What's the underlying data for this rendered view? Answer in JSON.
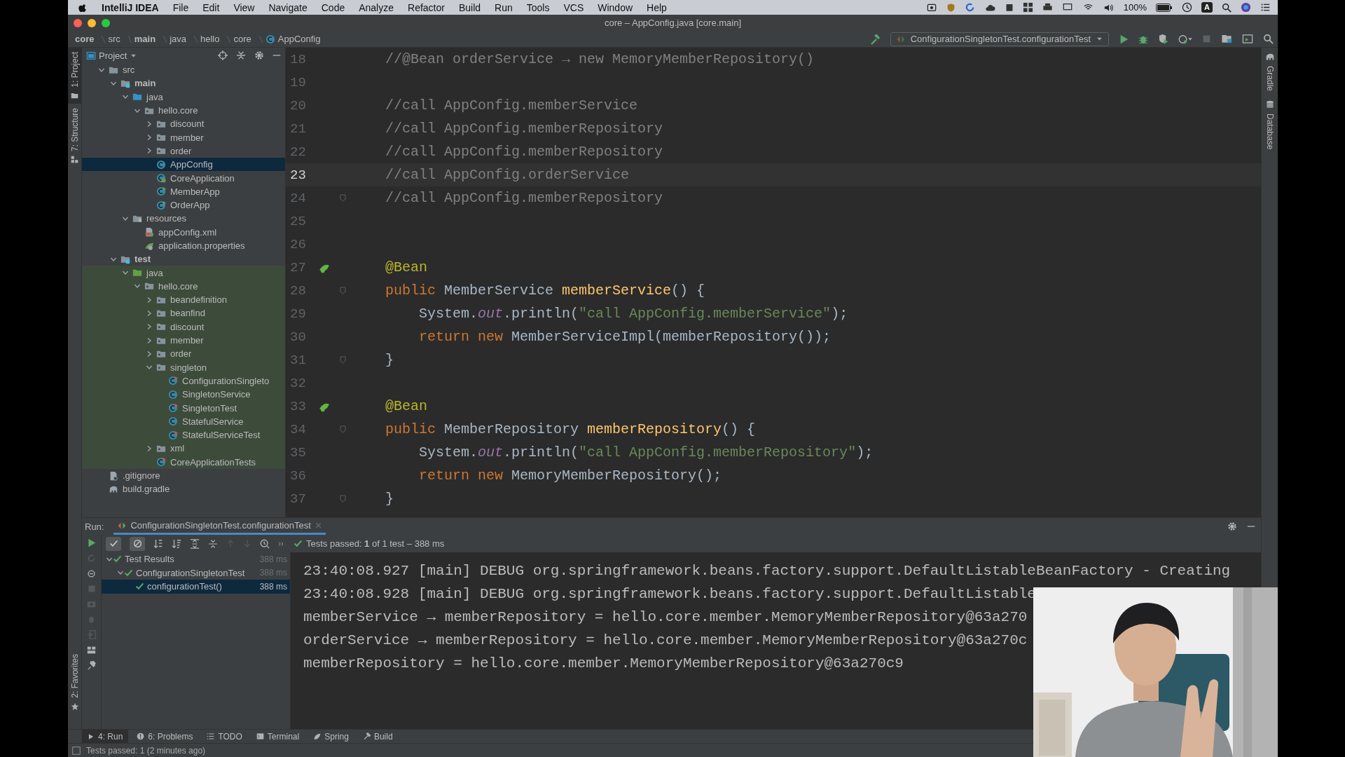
{
  "menu_bar": {
    "app": "IntelliJ IDEA",
    "items": [
      "File",
      "Edit",
      "View",
      "Navigate",
      "Code",
      "Analyze",
      "Refactor",
      "Build",
      "Run",
      "Tools",
      "VCS",
      "Window",
      "Help"
    ],
    "battery": "100%",
    "input_source": "A"
  },
  "window": {
    "title": "core – AppConfig.java [core.main]"
  },
  "breadcrumb": [
    {
      "label": "core",
      "kind": "module"
    },
    {
      "label": "src",
      "kind": "folder"
    },
    {
      "label": "main",
      "kind": "module"
    },
    {
      "label": "java",
      "kind": "folder"
    },
    {
      "label": "hello",
      "kind": "folder"
    },
    {
      "label": "core",
      "kind": "folder"
    },
    {
      "label": "AppConfig",
      "kind": "class"
    }
  ],
  "run_config": {
    "label": "ConfigurationSingletonTest.configurationTest"
  },
  "left_tool_tabs": [
    {
      "label": "1: Project",
      "selected": true
    },
    {
      "label": "7: Structure",
      "selected": false
    }
  ],
  "favorites_tab": {
    "label": "2: Favorites"
  },
  "right_tool_tabs": [
    {
      "label": "Gradle"
    },
    {
      "label": "Database"
    }
  ],
  "project_panel": {
    "title": "Project",
    "tree": [
      {
        "label": "src",
        "kind": "folder",
        "selected": false,
        "expanded": true,
        "children": [
          {
            "label": "main",
            "kind": "module",
            "selected": false,
            "expanded": true,
            "children": [
              {
                "label": "java",
                "kind": "source-root",
                "selected": false,
                "expanded": true,
                "children": [
                  {
                    "label": "hello.core",
                    "kind": "package",
                    "selected": false,
                    "expanded": true,
                    "children": [
                      {
                        "label": "discount",
                        "kind": "package",
                        "selected": false,
                        "expanded": false
                      },
                      {
                        "label": "member",
                        "kind": "package",
                        "selected": false,
                        "expanded": false
                      },
                      {
                        "label": "order",
                        "kind": "package",
                        "selected": false,
                        "expanded": false
                      },
                      {
                        "label": "AppConfig",
                        "kind": "class",
                        "selected": true
                      },
                      {
                        "label": "CoreApplication",
                        "kind": "spring-class",
                        "selected": false
                      },
                      {
                        "label": "MemberApp",
                        "kind": "runnable-class",
                        "selected": false
                      },
                      {
                        "label": "OrderApp",
                        "kind": "runnable-class",
                        "selected": false
                      }
                    ]
                  }
                ]
              },
              {
                "label": "resources",
                "kind": "resources-root",
                "selected": false,
                "expanded": true,
                "children": [
                  {
                    "label": "appConfig.xml",
                    "kind": "xml",
                    "selected": false
                  },
                  {
                    "label": "application.properties",
                    "kind": "properties",
                    "selected": false
                  }
                ]
              }
            ]
          },
          {
            "label": "test",
            "kind": "module",
            "selected": false,
            "expanded": true,
            "children": [
              {
                "label": "java",
                "kind": "test-root",
                "selected": false,
                "expanded": true,
                "children": [
                  {
                    "label": "hello.core",
                    "kind": "package",
                    "selected": false,
                    "expanded": true,
                    "children": [
                      {
                        "label": "beandefinition",
                        "kind": "package",
                        "selected": false,
                        "expanded": false
                      },
                      {
                        "label": "beanfind",
                        "kind": "package",
                        "selected": false,
                        "expanded": false
                      },
                      {
                        "label": "discount",
                        "kind": "package",
                        "selected": false,
                        "expanded": false
                      },
                      {
                        "label": "member",
                        "kind": "package",
                        "selected": false,
                        "expanded": false
                      },
                      {
                        "label": "order",
                        "kind": "package",
                        "selected": false,
                        "expanded": false
                      },
                      {
                        "label": "singleton",
                        "kind": "package",
                        "selected": false,
                        "expanded": true,
                        "children": [
                          {
                            "label": "ConfigurationSingleto",
                            "kind": "test-class",
                            "selected": false
                          },
                          {
                            "label": "SingletonService",
                            "kind": "class",
                            "selected": false
                          },
                          {
                            "label": "SingletonTest",
                            "kind": "test-class",
                            "selected": false
                          },
                          {
                            "label": "StatefulService",
                            "kind": "class",
                            "selected": false
                          },
                          {
                            "label": "StatefulServiceTest",
                            "kind": "test-class",
                            "selected": false
                          }
                        ]
                      },
                      {
                        "label": "xml",
                        "kind": "package",
                        "selected": false,
                        "expanded": false
                      },
                      {
                        "label": "CoreApplicationTests",
                        "kind": "test-class",
                        "selected": false
                      }
                    ]
                  }
                ]
              }
            ]
          }
        ]
      },
      {
        "label": ".gitignore",
        "kind": "file",
        "selected": false
      },
      {
        "label": "build.gradle",
        "kind": "gradle",
        "selected": false
      }
    ]
  },
  "editor": {
    "lines": [
      {
        "number": "18",
        "kind": "top",
        "current": false,
        "fold": false,
        "bean_marker": false,
        "tokens": [
          {
            "kind": "comment",
            "text": "//@Bean orderService → new MemoryMemberRepository()"
          }
        ]
      },
      {
        "number": "19",
        "kind": "blank",
        "current": false,
        "fold": false,
        "bean_marker": false
      },
      {
        "number": "20",
        "kind": "top",
        "current": false,
        "fold": false,
        "bean_marker": false,
        "tokens": [
          {
            "kind": "comment",
            "text": "//call AppConfig.memberService"
          }
        ]
      },
      {
        "number": "21",
        "kind": "top",
        "current": false,
        "fold": false,
        "bean_marker": false,
        "tokens": [
          {
            "kind": "comment",
            "text": "//call AppConfig.memberRepository"
          }
        ]
      },
      {
        "number": "22",
        "kind": "top",
        "current": false,
        "fold": false,
        "bean_marker": false,
        "tokens": [
          {
            "kind": "comment",
            "text": "//call AppConfig.memberRepository"
          }
        ]
      },
      {
        "number": "23",
        "kind": "top",
        "current": true,
        "fold": false,
        "bean_marker": false,
        "tokens": [
          {
            "kind": "comment",
            "text": "//call AppConfig.orderService"
          }
        ]
      },
      {
        "number": "24",
        "kind": "top",
        "current": false,
        "fold": true,
        "bean_marker": false,
        "tokens": [
          {
            "kind": "comment",
            "text": "//call AppConfig.memberRepository"
          }
        ]
      },
      {
        "number": "25",
        "kind": "blank",
        "current": false,
        "fold": false,
        "bean_marker": false
      },
      {
        "number": "26",
        "kind": "blank",
        "current": false,
        "fold": false,
        "bean_marker": false
      },
      {
        "number": "27",
        "kind": "top",
        "current": false,
        "fold": false,
        "bean_marker": true,
        "tokens": [
          {
            "kind": "annotation",
            "text": "@Bean"
          }
        ]
      },
      {
        "number": "28",
        "kind": "top",
        "current": false,
        "fold": true,
        "bean_marker": false,
        "tokens": [
          {
            "kind": "keyword",
            "text": "public"
          },
          {
            "kind": "plain",
            "text": " MemberService "
          },
          {
            "kind": "method",
            "text": "memberService"
          },
          {
            "kind": "plain",
            "text": "() {"
          }
        ]
      },
      {
        "number": "29",
        "kind": "body",
        "current": false,
        "fold": false,
        "bean_marker": false,
        "tokens": [
          {
            "kind": "plain",
            "text": "System."
          },
          {
            "kind": "field",
            "text": "out"
          },
          {
            "kind": "plain",
            "text": ".println("
          },
          {
            "kind": "string",
            "text": "\"call AppConfig.memberService\""
          },
          {
            "kind": "plain",
            "text": ");"
          }
        ]
      },
      {
        "number": "30",
        "kind": "body",
        "current": false,
        "fold": false,
        "bean_marker": false,
        "tokens": [
          {
            "kind": "keyword",
            "text": "return new"
          },
          {
            "kind": "plain",
            "text": " MemberServiceImpl(memberRepository());"
          }
        ]
      },
      {
        "number": "31",
        "kind": "top",
        "current": false,
        "fold": true,
        "bean_marker": false,
        "tokens": [
          {
            "kind": "plain",
            "text": "}"
          }
        ]
      },
      {
        "number": "32",
        "kind": "blank",
        "current": false,
        "fold": false,
        "bean_marker": false
      },
      {
        "number": "33",
        "kind": "top",
        "current": false,
        "fold": false,
        "bean_marker": true,
        "tokens": [
          {
            "kind": "annotation",
            "text": "@Bean"
          }
        ]
      },
      {
        "number": "34",
        "kind": "top",
        "current": false,
        "fold": true,
        "bean_marker": false,
        "tokens": [
          {
            "kind": "keyword",
            "text": "public"
          },
          {
            "kind": "plain",
            "text": " MemberRepository "
          },
          {
            "kind": "method",
            "text": "memberRepository"
          },
          {
            "kind": "plain",
            "text": "() {"
          }
        ]
      },
      {
        "number": "35",
        "kind": "body",
        "current": false,
        "fold": false,
        "bean_marker": false,
        "tokens": [
          {
            "kind": "plain",
            "text": "System."
          },
          {
            "kind": "field",
            "text": "out"
          },
          {
            "kind": "plain",
            "text": ".println("
          },
          {
            "kind": "string",
            "text": "\"call AppConfig.memberRepository\""
          },
          {
            "kind": "plain",
            "text": ");"
          }
        ]
      },
      {
        "number": "36",
        "kind": "body",
        "current": false,
        "fold": false,
        "bean_marker": false,
        "tokens": [
          {
            "kind": "keyword",
            "text": "return new"
          },
          {
            "kind": "plain",
            "text": " MemoryMemberRepository();"
          }
        ]
      },
      {
        "number": "37",
        "kind": "top",
        "current": false,
        "fold": true,
        "bean_marker": false,
        "tokens": [
          {
            "kind": "plain",
            "text": "}"
          }
        ]
      }
    ]
  },
  "run_panel": {
    "label": "Run:",
    "tab": "ConfigurationSingletonTest.configurationTest",
    "toggles": [
      {
        "kind": "show-passed",
        "on": true
      },
      {
        "kind": "show-ignored",
        "on": true
      }
    ],
    "summary": "Tests passed: **1** of 1 test – 388 ms",
    "tests": [
      {
        "label": "Test Results",
        "time": "388 ms",
        "selected": false,
        "expanded": true,
        "children": [
          {
            "label": "ConfigurationSingletonTest",
            "time": "388 ms",
            "selected": false,
            "expanded": true,
            "children": [
              {
                "label": "configurationTest()",
                "time": "388 ms",
                "selected": true
              }
            ]
          }
        ]
      }
    ],
    "console": [
      "23:40:08.927 [main] DEBUG org.springframework.beans.factory.support.DefaultListableBeanFactory - Creating",
      "23:40:08.928 [main] DEBUG org.springframework.beans.factory.support.DefaultListable",
      "memberService → memberRepository = hello.core.member.MemoryMemberRepository@63a270",
      "orderService → memberRepository = hello.core.member.MemoryMemberRepository@63a270c",
      "memberRepository = hello.core.member.MemoryMemberRepository@63a270c9"
    ]
  },
  "bottom_tabs": [
    {
      "label": "4: Run",
      "kind": "run",
      "selected": true
    },
    {
      "label": "6: Problems",
      "kind": "problems",
      "selected": false
    },
    {
      "label": "TODO",
      "kind": "todo",
      "selected": false
    },
    {
      "label": "Terminal",
      "kind": "terminal",
      "selected": false
    },
    {
      "label": "Spring",
      "kind": "spring",
      "selected": false
    },
    {
      "label": "Build",
      "kind": "build",
      "selected": false
    }
  ],
  "status_bar": {
    "text": "Tests passed: 1 (2 minutes ago)"
  }
}
